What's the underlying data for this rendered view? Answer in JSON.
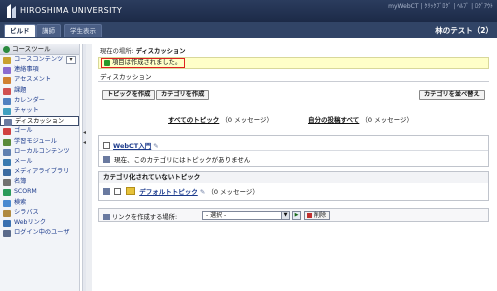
{
  "banner": {
    "university": "HIROSHIMA UNIVERSITY",
    "top_links": "myWebCT | ｸﾘｯｸﾌﾞﾛｸﾞ | ﾍﾙﾌﾟ | ﾛｸﾞｱｳﾄ"
  },
  "tabs": [
    {
      "label": "ビルド",
      "active": true
    },
    {
      "label": "講師",
      "active": false
    },
    {
      "label": "学生表示",
      "active": false
    }
  ],
  "course_title": "林のテスト（2）",
  "left_menu": {
    "header": "コースツール",
    "items": [
      {
        "label": "コースコンテンツ",
        "icon": "content-icon",
        "color": "#c8a030"
      },
      {
        "label": "連絡事項",
        "icon": "announcement-icon",
        "color": "#8a6ad0"
      },
      {
        "label": "アセスメント",
        "icon": "assessment-icon",
        "color": "#d08030"
      },
      {
        "label": "課題",
        "icon": "assignment-icon",
        "color": "#d05050"
      },
      {
        "label": "カレンダー",
        "icon": "calendar-icon",
        "color": "#5080c0"
      },
      {
        "label": "チャット",
        "icon": "chat-icon",
        "color": "#40a0c0"
      },
      {
        "label": "ディスカッション",
        "icon": "discussion-icon",
        "color": "#6a7aa0",
        "selected": true
      },
      {
        "label": "ゴール",
        "icon": "goal-icon",
        "color": "#d04040"
      },
      {
        "label": "学習モジュール",
        "icon": "module-icon",
        "color": "#5a8a3a"
      },
      {
        "label": "ローカルコンテンツ",
        "icon": "local-content-icon",
        "color": "#6080b0"
      },
      {
        "label": "メール",
        "icon": "mail-icon",
        "color": "#3a7ab0"
      },
      {
        "label": "メディアライブラリ",
        "icon": "media-library-icon",
        "color": "#3a6aa0"
      },
      {
        "label": "名簿",
        "icon": "roster-icon",
        "color": "#707070"
      },
      {
        "label": "SCORM",
        "icon": "scorm-icon",
        "color": "#2a9a5a"
      },
      {
        "label": "検索",
        "icon": "search-icon",
        "color": "#4a8ad0"
      },
      {
        "label": "シラバス",
        "icon": "syllabus-icon",
        "color": "#b08a40"
      },
      {
        "label": "Webリンク",
        "icon": "weblink-icon",
        "color": "#3a70b0"
      },
      {
        "label": "ログイン中のユーザ",
        "icon": "users-online-icon",
        "color": "#5a6a8a"
      }
    ]
  },
  "breadcrumb": {
    "prefix": "現在の場所: ",
    "current": "ディスカッション"
  },
  "message": "項目は作成されました。",
  "page_title": "ディスカッション",
  "buttons": {
    "create_topic": "トピックを作成",
    "create_category": "カテゴリを作成",
    "reorder_categories": "カテゴリを並べ替え"
  },
  "stats": {
    "all_topics_link": "すべてのトピック",
    "all_topics_count": "（0 メッセージ）",
    "my_posts_link": "自分の投稿すべて",
    "my_posts_count": "（0 メッセージ）"
  },
  "category1": {
    "name": "WebCT入門",
    "empty_text": "現在、このカテゴリにはトピックがありません"
  },
  "category2": {
    "header": "カテゴリ化されていないトピック",
    "topic_name": "デフォルトトピック",
    "topic_count": "（0 メッセージ）"
  },
  "link_bar": {
    "label": "リンクを作成する場所:",
    "select_value": "- 選択 -",
    "delete_label": "削除"
  }
}
